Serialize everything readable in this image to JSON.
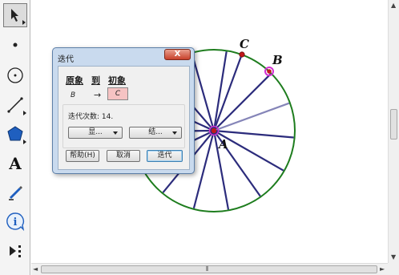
{
  "toolbar": {
    "tools": [
      {
        "icon": "arrow-select-icon"
      },
      {
        "icon": "point-icon"
      },
      {
        "icon": "compass-circle-icon"
      },
      {
        "icon": "straightedge-icon"
      },
      {
        "icon": "polygon-icon"
      },
      {
        "icon": "text-icon",
        "glyph": "A"
      },
      {
        "icon": "marker-pen-icon"
      },
      {
        "icon": "information-icon",
        "glyph": "i"
      },
      {
        "icon": "custom-tools-icon"
      }
    ]
  },
  "canvas": {
    "points": {
      "A": "A",
      "B": "B",
      "C": "C"
    },
    "colors": {
      "circle": "#1e7d1e",
      "segments": "#2c2c7c",
      "highlight_segment": "#8585b8",
      "point_fill": "#c0181a",
      "selected_ring": "#d22fd2"
    }
  },
  "dialog": {
    "title": "迭代",
    "close_label": "X",
    "header_pre_image": "原象",
    "header_to": "到",
    "header_image": "初象",
    "map_source": "B",
    "map_arrow": "→",
    "map_target": "C",
    "iteration_count_label": "迭代次数: 14.",
    "display_dropdown": "显...",
    "structure_dropdown": "结...",
    "help_button": "帮助(H)",
    "cancel_button": "取消",
    "iterate_button": "迭代"
  },
  "scrollbars": {
    "up": "▲",
    "down": "▼",
    "left": "◄",
    "right": "►",
    "grip": "⦀"
  }
}
